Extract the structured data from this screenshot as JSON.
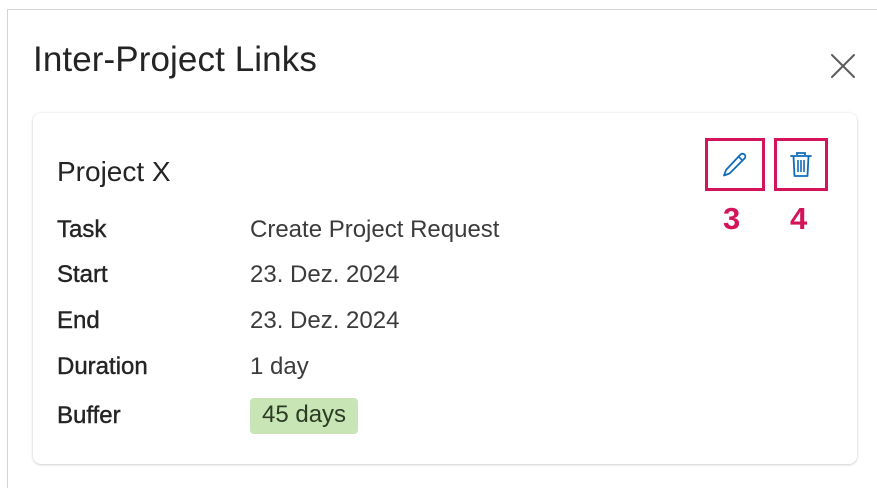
{
  "dialog": {
    "title": "Inter-Project Links",
    "close_icon": "close-icon"
  },
  "card": {
    "project_name": "Project X",
    "edit_icon": "pencil-icon",
    "delete_icon": "trash-icon",
    "annotations": {
      "edit": "3",
      "delete": "4"
    },
    "fields": {
      "task": {
        "label": "Task",
        "value": "Create Project Request"
      },
      "start": {
        "label": "Start",
        "value": "23. Dez. 2024"
      },
      "end": {
        "label": "End",
        "value": "23. Dez. 2024"
      },
      "duration": {
        "label": "Duration",
        "value": "1 day"
      },
      "buffer": {
        "label": "Buffer",
        "value": "45 days"
      }
    }
  },
  "colors": {
    "accent": "#0f6cbd",
    "annotation": "#d4145a",
    "buffer_badge": "#c7e5b5"
  }
}
